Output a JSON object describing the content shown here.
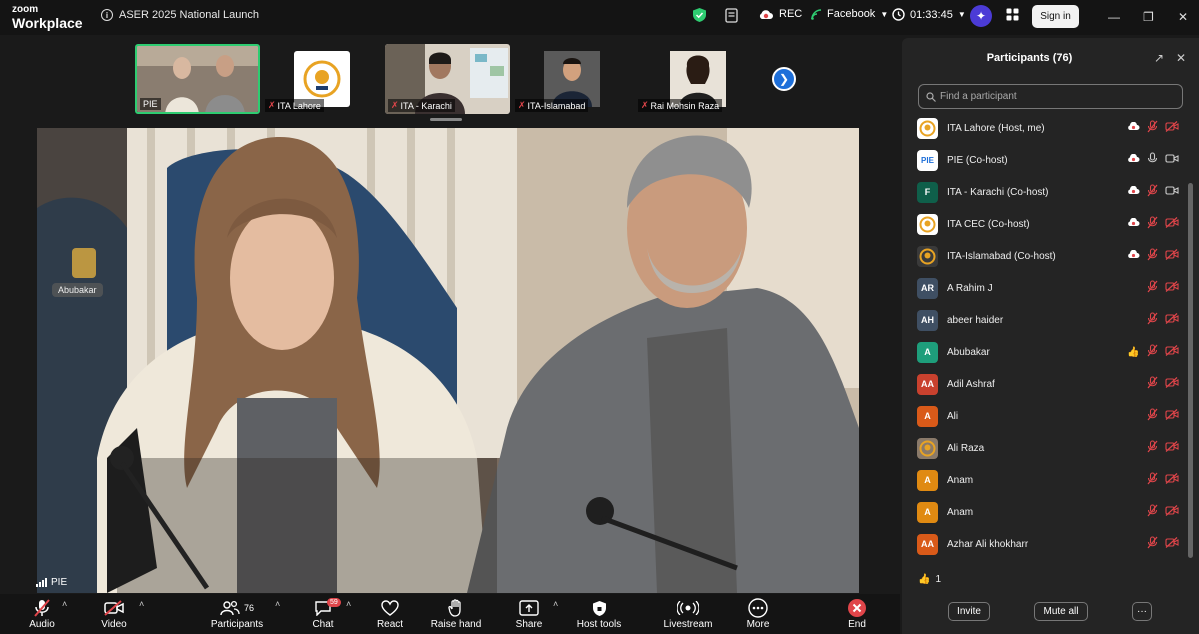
{
  "app": {
    "brand_top": "zoom",
    "brand_bottom": "Workplace",
    "meeting_title": "ASER 2025 National Launch"
  },
  "header": {
    "rec_label": "REC",
    "stream_label": "Facebook",
    "timer": "01:33:45",
    "sign_in": "Sign in"
  },
  "thumbnails": [
    {
      "label": "PIE"
    },
    {
      "label": "ITA Lahore"
    },
    {
      "label": "ITA - Karachi"
    },
    {
      "label": "ITA-Islamabad"
    },
    {
      "label": "Rai Mohsin Raza"
    }
  ],
  "main_video": {
    "speaker_name": "PIE",
    "float_name": "Abubakar"
  },
  "toolbar": {
    "audio": "Audio",
    "video": "Video",
    "participants": "Participants",
    "participants_count": "76",
    "chat": "Chat",
    "chat_badge": "59",
    "react": "React",
    "raise_hand": "Raise hand",
    "share": "Share",
    "host_tools": "Host tools",
    "livestream": "Livestream",
    "more": "More",
    "end": "End"
  },
  "panel": {
    "title": "Participants (76)",
    "search_placeholder": "Find a participant",
    "participants": [
      {
        "name": "ITA Lahore (Host, me)",
        "initials": "",
        "color": "#ffffff",
        "cloud": true,
        "mic": "muted",
        "cam": "off"
      },
      {
        "name": "PIE (Co-host)",
        "initials": "PIE",
        "color": "#ffffff",
        "cloud": true,
        "mic": "on",
        "cam": "on"
      },
      {
        "name": "ITA - Karachi (Co-host)",
        "initials": "F",
        "color": "#0f5f4a",
        "cloud": true,
        "mic": "muted",
        "cam": "on"
      },
      {
        "name": "ITA CEC (Co-host)",
        "initials": "",
        "color": "#ffffff",
        "cloud": true,
        "mic": "muted",
        "cam": "off"
      },
      {
        "name": "ITA-Islamabad (Co-host)",
        "initials": "",
        "color": "#3a3a3a",
        "cloud": true,
        "mic": "muted",
        "cam": "off"
      },
      {
        "name": "A Rahim J",
        "initials": "AR",
        "color": "#3f4f63",
        "cloud": false,
        "mic": "muted",
        "cam": "off"
      },
      {
        "name": "abeer haider",
        "initials": "AH",
        "color": "#3f4f63",
        "cloud": false,
        "mic": "muted",
        "cam": "off"
      },
      {
        "name": "Abubakar",
        "initials": "A",
        "color": "#1e9e7b",
        "cloud": false,
        "mic": "muted",
        "cam": "off",
        "hand": true
      },
      {
        "name": "Adil Ashraf",
        "initials": "AA",
        "color": "#c9412e",
        "cloud": false,
        "mic": "muted",
        "cam": "off"
      },
      {
        "name": "Ali",
        "initials": "A",
        "color": "#d95a19",
        "cloud": false,
        "mic": "muted",
        "cam": "off"
      },
      {
        "name": "Ali Raza",
        "initials": "",
        "color": "#8a7a6a",
        "cloud": false,
        "mic": "muted",
        "cam": "off"
      },
      {
        "name": "Anam",
        "initials": "A",
        "color": "#e08a12",
        "cloud": false,
        "mic": "muted",
        "cam": "off"
      },
      {
        "name": "Anam",
        "initials": "A",
        "color": "#e08a12",
        "cloud": false,
        "mic": "muted",
        "cam": "off"
      },
      {
        "name": "Azhar Ali khokharr",
        "initials": "AA",
        "color": "#d95a19",
        "cloud": false,
        "mic": "muted",
        "cam": "off"
      }
    ],
    "reaction_count": "1",
    "invite": "Invite",
    "mute_all": "Mute all",
    "more": "···"
  }
}
